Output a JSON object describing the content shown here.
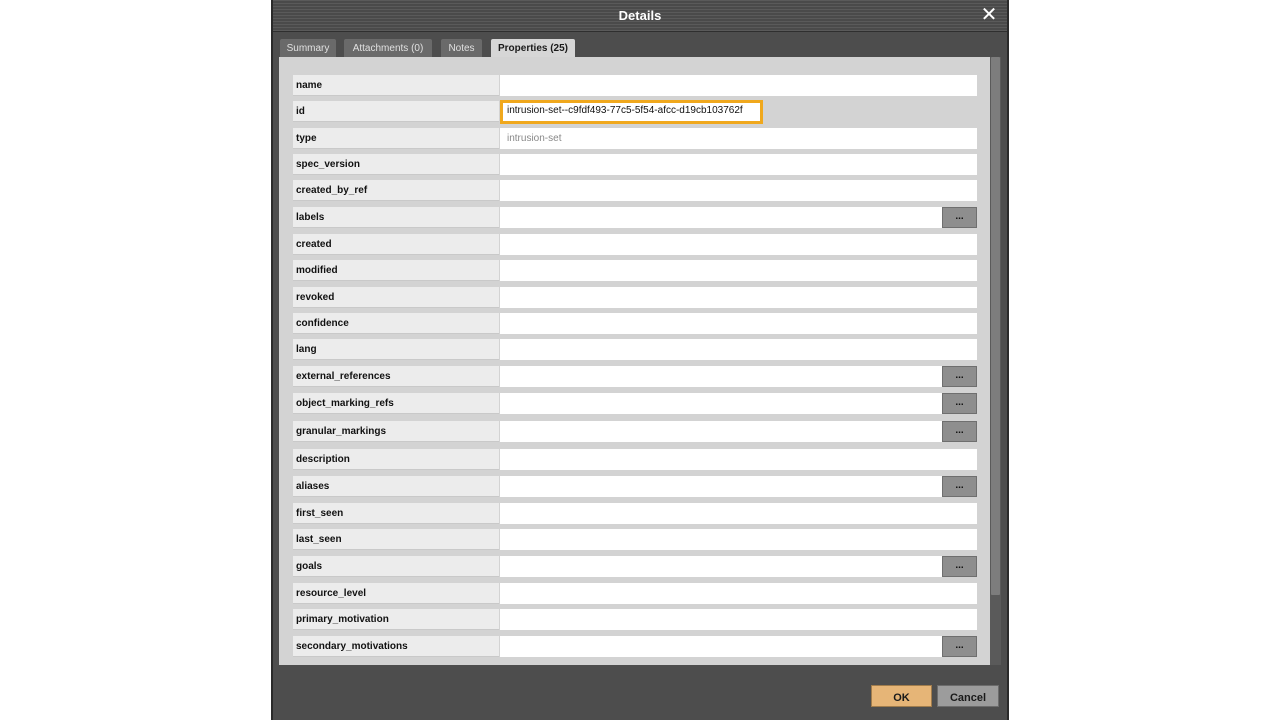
{
  "dialog": {
    "title": "Details",
    "close_icon": "✕"
  },
  "tabs": [
    {
      "label": "Summary",
      "active": false
    },
    {
      "label": "Attachments (0)",
      "active": false
    },
    {
      "label": "Notes",
      "active": false
    },
    {
      "label": "Properties (25)",
      "active": true
    }
  ],
  "properties": [
    {
      "name": "name",
      "value": "",
      "has_button": false
    },
    {
      "name": "id",
      "value": "intrusion-set--c9fdf493-77c5-5f54-afcc-d19cb103762f",
      "has_button": false,
      "highlighted": true
    },
    {
      "name": "type",
      "value": "intrusion-set",
      "has_button": false
    },
    {
      "name": "spec_version",
      "value": "",
      "has_button": false
    },
    {
      "name": "created_by_ref",
      "value": "",
      "has_button": false
    },
    {
      "name": "labels",
      "value": "",
      "has_button": true
    },
    {
      "name": "created",
      "value": "",
      "has_button": false
    },
    {
      "name": "modified",
      "value": "",
      "has_button": false
    },
    {
      "name": "revoked",
      "value": "",
      "has_button": false
    },
    {
      "name": "confidence",
      "value": "",
      "has_button": false
    },
    {
      "name": "lang",
      "value": "",
      "has_button": false
    },
    {
      "name": "external_references",
      "value": "",
      "has_button": true
    },
    {
      "name": "object_marking_refs",
      "value": "",
      "has_button": true
    },
    {
      "name": "granular_markings",
      "value": "",
      "has_button": true
    },
    {
      "name": "description",
      "value": "",
      "has_button": false
    },
    {
      "name": "aliases",
      "value": "",
      "has_button": true
    },
    {
      "name": "first_seen",
      "value": "",
      "has_button": false
    },
    {
      "name": "last_seen",
      "value": "",
      "has_button": false
    },
    {
      "name": "goals",
      "value": "",
      "has_button": true
    },
    {
      "name": "resource_level",
      "value": "",
      "has_button": false
    },
    {
      "name": "primary_motivation",
      "value": "",
      "has_button": false
    },
    {
      "name": "secondary_motivations",
      "value": "",
      "has_button": true
    }
  ],
  "ellipsis_label": "...",
  "buttons": {
    "ok_label": "OK",
    "cancel_label": "Cancel"
  },
  "colors": {
    "highlight": "#f0a81d",
    "ok_button": "#e6b577"
  }
}
